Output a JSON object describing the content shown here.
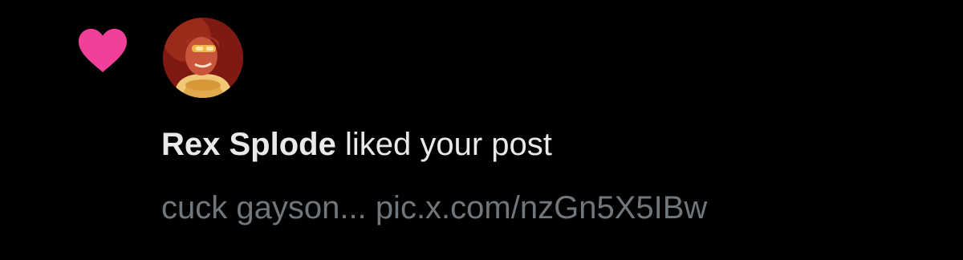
{
  "notification": {
    "icon": "heart-icon",
    "icon_color": "#f0409a",
    "avatar": "avatar-icon",
    "user_name": "Rex Splode",
    "action_text": "liked your post",
    "post_preview": "cuck gayson...",
    "post_link": "pic.x.com/nzGn5X5IBw"
  },
  "colors": {
    "background": "#000000",
    "primary_text": "#e7e9ea",
    "secondary_text": "#71767b"
  }
}
